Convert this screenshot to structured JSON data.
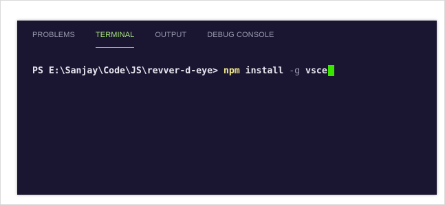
{
  "panel": {
    "tabs": [
      {
        "label": "PROBLEMS",
        "active": false
      },
      {
        "label": "TERMINAL",
        "active": true
      },
      {
        "label": "OUTPUT",
        "active": false
      },
      {
        "label": "DEBUG CONSOLE",
        "active": false
      }
    ]
  },
  "terminal": {
    "prompt": "PS E:\\Sanjay\\Code\\JS\\revver-d-eye> ",
    "command": "npm",
    "arg1": " install ",
    "flag": "-g",
    "arg2": " vsce"
  },
  "colors": {
    "panel_background": "#1a1632",
    "active_tab": "#a9e57a",
    "inactive_tab": "#9a9ab0",
    "command": "#f0e68c",
    "cursor": "#39e600"
  }
}
